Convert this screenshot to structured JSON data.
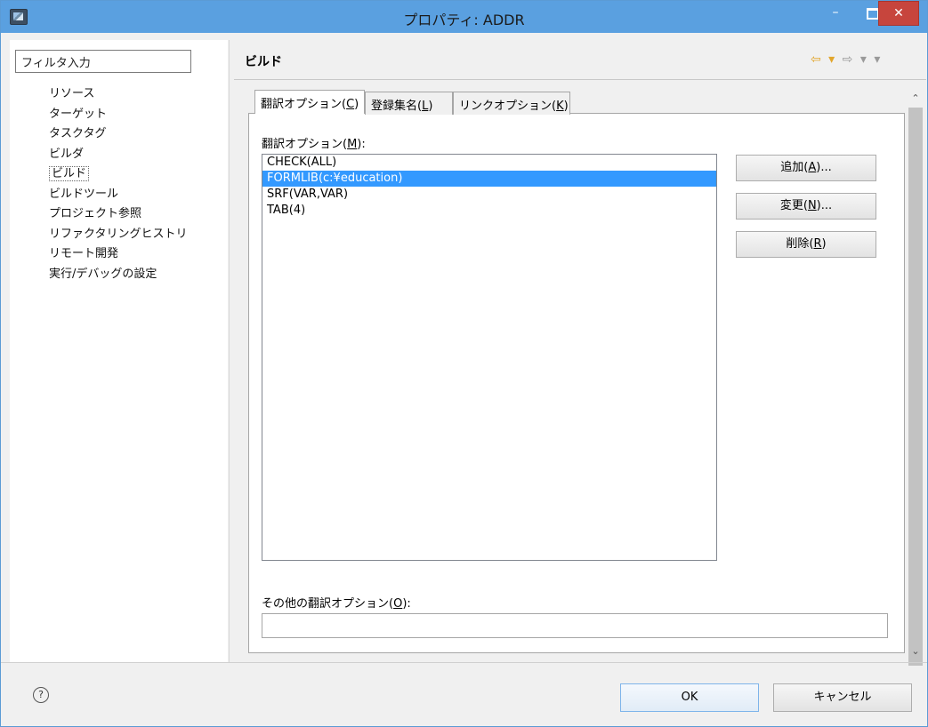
{
  "window": {
    "title": "プロパティ: ADDR",
    "minimize_glyph": "–",
    "close_glyph": "✕"
  },
  "sidebar": {
    "filter_text": "フィルタ入力",
    "items": [
      {
        "label": "リソース"
      },
      {
        "label": "ターゲット"
      },
      {
        "label": "タスクタグ"
      },
      {
        "label": "ビルダ"
      },
      {
        "label": "ビルド",
        "selected": true
      },
      {
        "label": "ビルドツール"
      },
      {
        "label": "プロジェクト参照"
      },
      {
        "label": "リファクタリングヒストリ"
      },
      {
        "label": "リモート開発"
      },
      {
        "label": "実行/デバッグの設定"
      }
    ]
  },
  "main": {
    "page_title": "ビルド",
    "nav": {
      "back": "⇦ ▾",
      "forward": "⇨ ▾",
      "menu": "▾"
    },
    "tabs": [
      {
        "label": "翻訳オプション(",
        "mnemonic": "C",
        "suffix": ")",
        "active": true
      },
      {
        "label": "登録集名(",
        "mnemonic": "L",
        "suffix": ")"
      },
      {
        "label": "リンクオプション(",
        "mnemonic": "K",
        "suffix": ")"
      }
    ],
    "options_label": {
      "text": "翻訳オプション(",
      "mnemonic": "M",
      "suffix": "):"
    },
    "options_list": [
      {
        "text": "CHECK(ALL)"
      },
      {
        "text": "FORMLIB(c:¥education)",
        "selected": true
      },
      {
        "text": "SRF(VAR,VAR)"
      },
      {
        "text": "TAB(4)"
      }
    ],
    "buttons": {
      "add": {
        "text": "追加(",
        "mnemonic": "A",
        "suffix": ")..."
      },
      "edit": {
        "text": "変更(",
        "mnemonic": "N",
        "suffix": ")..."
      },
      "delete": {
        "text": "削除(",
        "mnemonic": "R",
        "suffix": ")"
      }
    },
    "other_label": {
      "text": "その他の翻訳オプション(",
      "mnemonic": "O",
      "suffix": "):"
    },
    "other_value": ""
  },
  "footer": {
    "help_glyph": "?",
    "ok": "OK",
    "cancel": "キャンセル"
  },
  "colors": {
    "titlebar": "#5aa0e0",
    "selection": "#3399ff",
    "close": "#c7453d"
  }
}
